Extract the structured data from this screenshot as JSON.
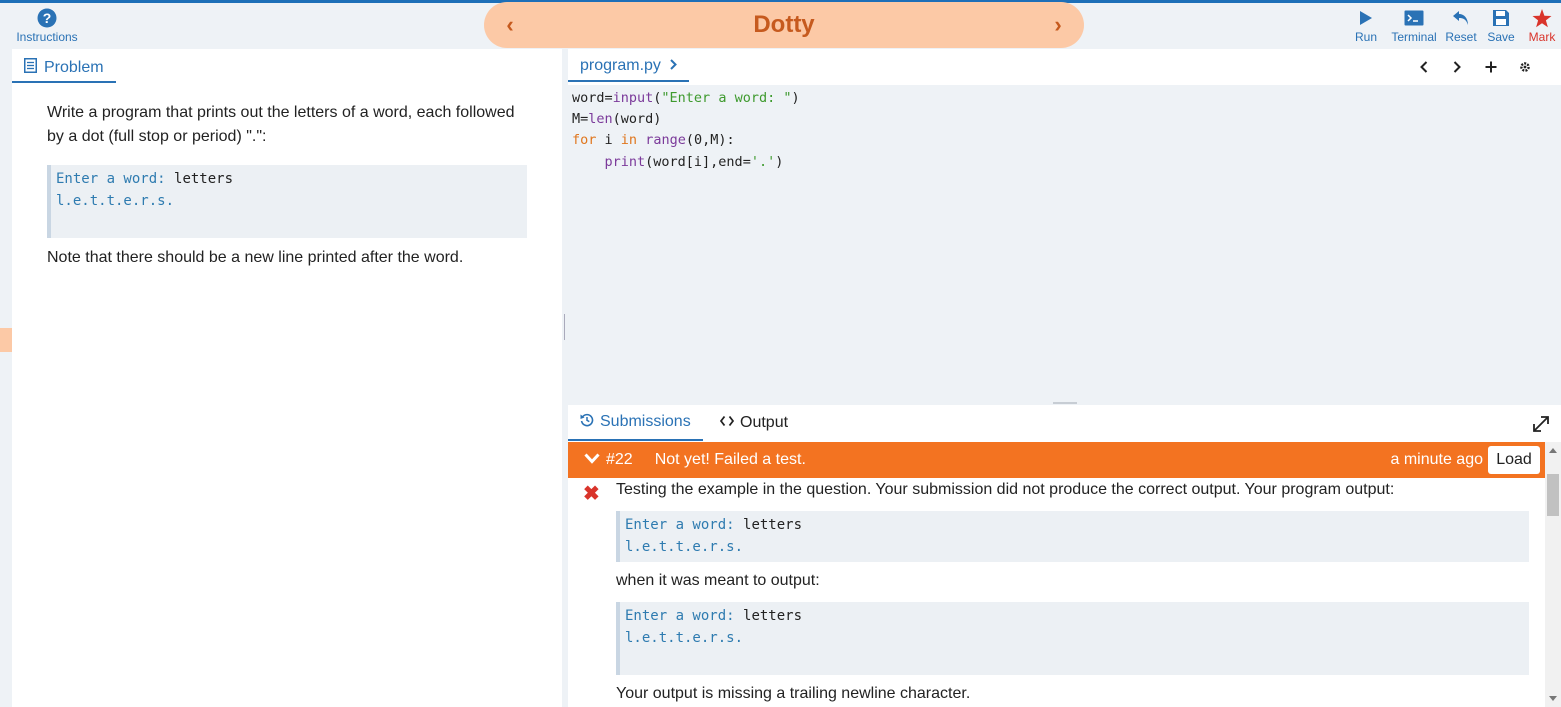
{
  "toolbar": {
    "instructions_label": "Instructions",
    "run_label": "Run",
    "terminal_label": "Terminal",
    "reset_label": "Reset",
    "save_label": "Save",
    "mark_label": "Mark"
  },
  "lesson": {
    "title": "Dotty",
    "prev_icon": "chevron-left-icon",
    "next_icon": "chevron-right-icon"
  },
  "problem": {
    "tab_label": "Problem",
    "intro": "Write a program that prints out the letters of a word, each followed by a dot (full stop or period) \".\":",
    "example": {
      "prompt": "Enter a word: ",
      "input": "letters",
      "output": "l.e.t.t.e.r.s."
    },
    "note": "Note that there should be a new line printed after the word."
  },
  "editor": {
    "file_tab": "program.py",
    "lines": [
      "word=input(\"Enter a word: \")",
      "M=len(word)",
      "for i in range(0,M):",
      "    print(word[i],end='.')"
    ]
  },
  "output_panel": {
    "tabs": [
      {
        "label": "Submissions",
        "icon": "history-icon"
      },
      {
        "label": "Output",
        "icon": "code-icon"
      }
    ],
    "submission": {
      "number": "#22",
      "status": "Not yet! Failed a test.",
      "when": "a minute ago",
      "load_label": "Load",
      "status_color": "#f37321",
      "test_message": "Testing the example in the question. Your submission did not produce the correct output. Your program output:",
      "program_output": {
        "prompt": "Enter a word: ",
        "input": "letters",
        "output": "l.e.t.t.e.r.s."
      },
      "expected_label": "when it was meant to output:",
      "expected_output": {
        "prompt": "Enter a word: ",
        "input": "letters",
        "output": "l.e.t.t.e.r.s."
      },
      "hint": "Your output is missing a trailing newline character."
    }
  },
  "colors": {
    "accent": "#2a72b5",
    "title_pill": "#fcc9a6",
    "title_text": "#c65a1e",
    "fail": "#d9342b"
  }
}
